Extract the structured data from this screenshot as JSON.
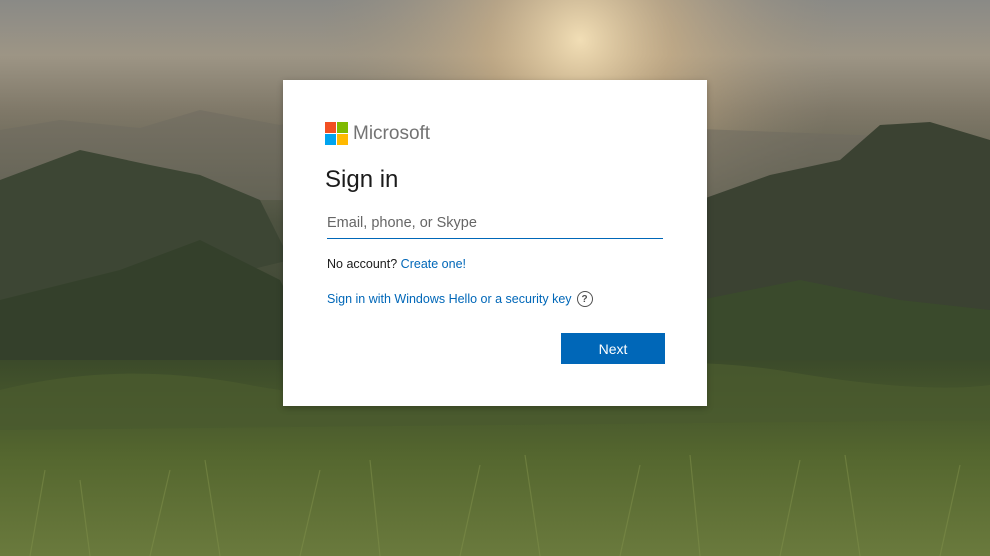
{
  "brand": {
    "name": "Microsoft",
    "logo_colors": [
      "#f25022",
      "#7fba00",
      "#00a4ef",
      "#ffb900"
    ]
  },
  "signin": {
    "title": "Sign in",
    "email_placeholder": "Email, phone, or Skype",
    "email_value": "",
    "no_account_text": "No account?",
    "create_link": "Create one!",
    "hello_link": "Sign in with Windows Hello or a security key",
    "help_icon": "?",
    "next_label": "Next"
  },
  "colors": {
    "accent": "#0067b8",
    "card_bg": "#ffffff"
  }
}
